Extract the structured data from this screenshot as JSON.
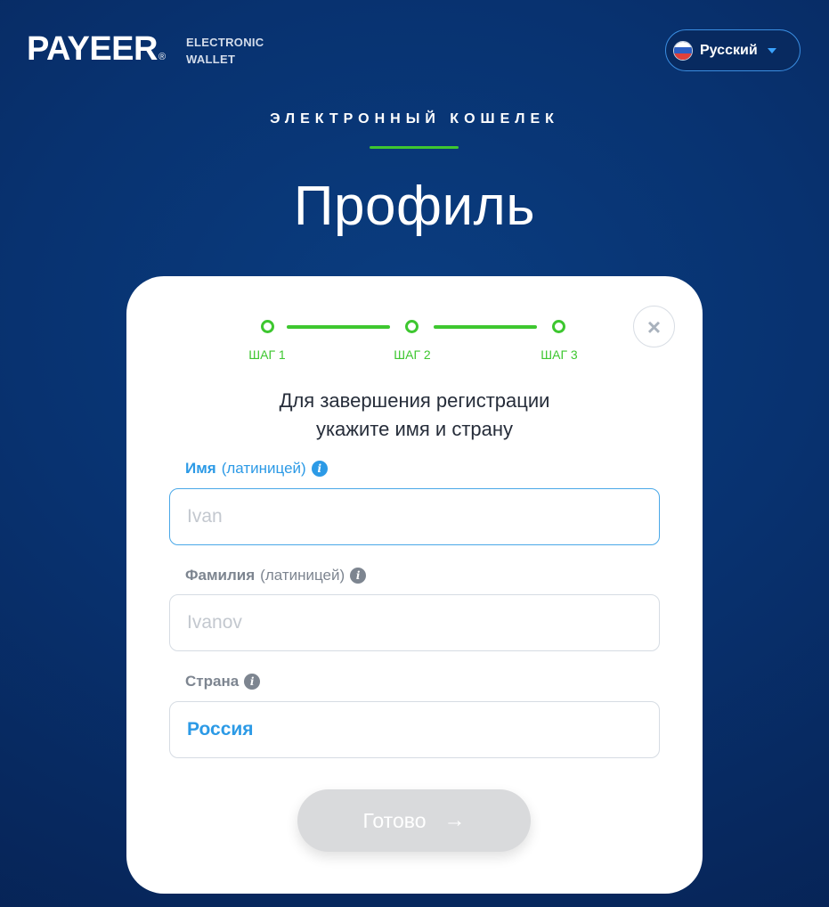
{
  "header": {
    "logo": "PAYEER",
    "logo_mark": "®",
    "tagline_line1": "ELECTRONIC",
    "tagline_line2": "WALLET",
    "language": {
      "label": "Русский",
      "flag_icon": "russia-flag-icon",
      "flag_colors": [
        "#ffffff",
        "#2d5fc4",
        "#e0403a"
      ]
    }
  },
  "hero": {
    "subtitle": "ЭЛЕКТРОННЫЙ КОШЕЛЕК",
    "title": "Профиль"
  },
  "card": {
    "close_icon": "close-icon",
    "steps": [
      {
        "label": "ШАГ 1"
      },
      {
        "label": "ШАГ 2"
      },
      {
        "label": "ШАГ 3"
      }
    ],
    "intro_line1": "Для завершения регистрации",
    "intro_line2": "укажите имя и страну",
    "first_name": {
      "label": "Имя",
      "hint": "(латиницей)",
      "placeholder": "Ivan",
      "value": ""
    },
    "last_name": {
      "label": "Фамилия",
      "hint": "(латиницей)",
      "placeholder": "Ivanov",
      "value": ""
    },
    "country": {
      "label": "Страна",
      "value": "Россия"
    },
    "submit": {
      "label": "Готово",
      "arrow": "→"
    }
  },
  "colors": {
    "accent_green": "#3ec730",
    "accent_blue": "#2c9ae6",
    "background": "#083270"
  }
}
